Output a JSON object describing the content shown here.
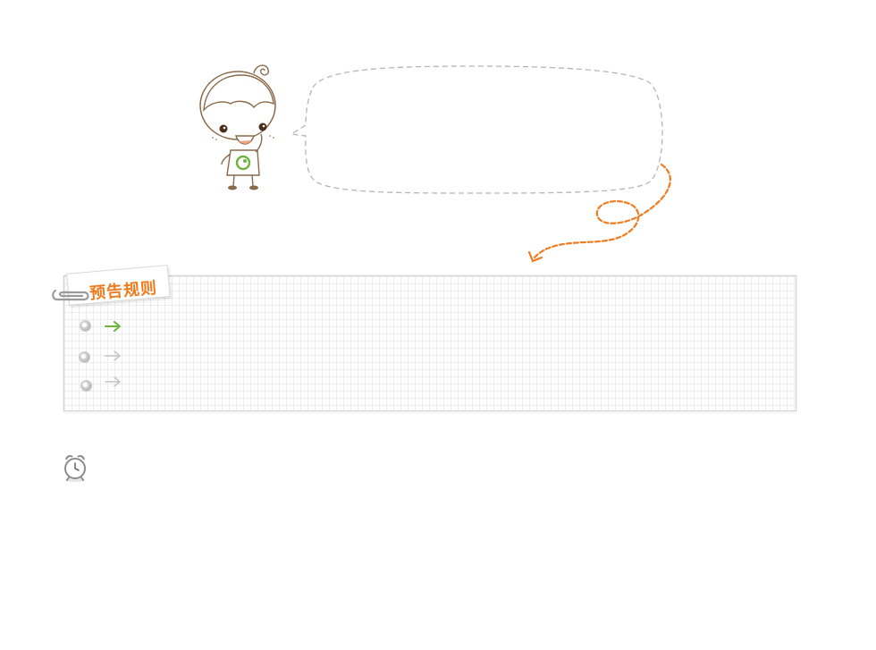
{
  "rules": {
    "title": "预告规则",
    "items": [
      {
        "state": "active",
        "color": "#6cb33e"
      },
      {
        "state": "inactive",
        "color": "#c4c4c4"
      },
      {
        "state": "inactive",
        "color": "#c4c4c4"
      }
    ]
  },
  "colors": {
    "accent_orange": "#f07b1e",
    "accent_green": "#6cb33e",
    "line_brown": "#8a6a4a",
    "dash_gray": "#b5b5b5"
  },
  "icons": {
    "mascot": "cartoon-boy-icon",
    "bubble": "speech-bubble",
    "clip": "paperclip-icon",
    "clock": "alarm-clock-icon"
  }
}
